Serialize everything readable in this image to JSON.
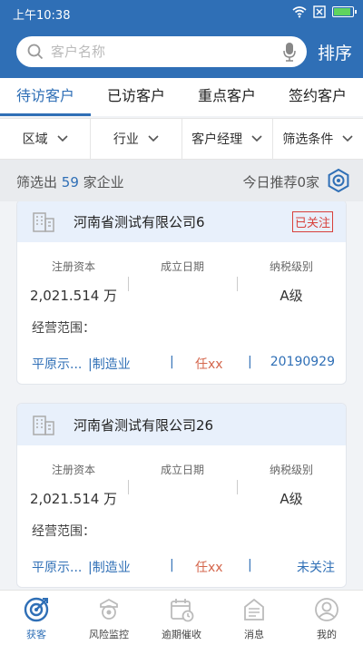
{
  "status_bar": {
    "time": "上午10:38"
  },
  "search": {
    "placeholder": "客户名称"
  },
  "header": {
    "sort_label": "排序"
  },
  "tabs": [
    {
      "label": "待访客户",
      "active": true
    },
    {
      "label": "已访客户",
      "active": false
    },
    {
      "label": "重点客户",
      "active": false
    },
    {
      "label": "签约客户",
      "active": false
    }
  ],
  "filters": [
    {
      "label": "区域"
    },
    {
      "label": "行业"
    },
    {
      "label": "客户经理"
    },
    {
      "label": "筛选条件"
    }
  ],
  "summary": {
    "prefix": "筛选出",
    "count": "59",
    "suffix": "家企业",
    "recommend": "今日推荐0家"
  },
  "card_labels": {
    "capital": "注册资本",
    "founded": "成立日期",
    "tax_level": "纳税级别",
    "scope": "经营范围："
  },
  "companies": [
    {
      "name": "河南省测试有限公司6",
      "capital": "2,021.514 万",
      "founded": "",
      "tax_level": "A级",
      "region": "平原示...",
      "industry": "|制造业",
      "sep1": "|",
      "manager": "任xx",
      "sep2": "|",
      "end_value": "20190929",
      "badge": "已关注"
    },
    {
      "name": "河南省测试有限公司26",
      "capital": "2,021.514 万",
      "founded": "",
      "tax_level": "A级",
      "region": "平原示...",
      "industry": "|制造业",
      "sep1": "|",
      "manager": "任xx",
      "sep2": "|",
      "end_value": "未关注",
      "badge": ""
    }
  ],
  "bottom_nav": [
    {
      "label": "获客",
      "icon": "target-icon",
      "active": true
    },
    {
      "label": "风险监控",
      "icon": "camera-icon",
      "active": false
    },
    {
      "label": "逾期催收",
      "icon": "calendar-clock-icon",
      "active": false
    },
    {
      "label": "消息",
      "icon": "message-icon",
      "active": false
    },
    {
      "label": "我的",
      "icon": "user-icon",
      "active": false
    }
  ],
  "colors": {
    "primary": "#2f6fb6",
    "header_bg": "#2f6fb6",
    "card_head_bg": "#e8f0fb",
    "badge_red": "#d8403b",
    "manager_text": "#d4664c"
  }
}
